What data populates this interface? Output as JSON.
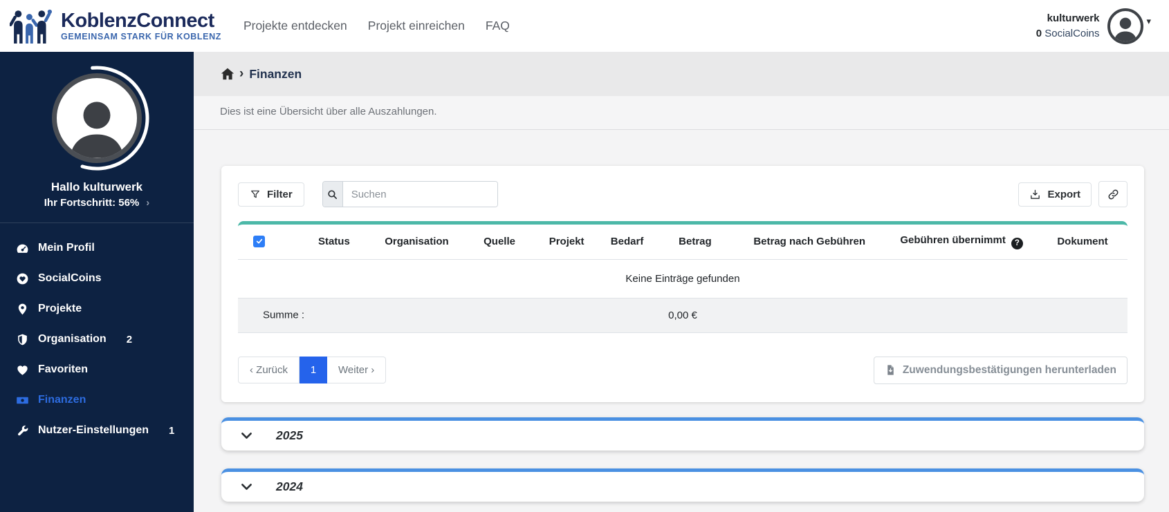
{
  "header": {
    "logo_title": "KoblenzConnect",
    "logo_tagline": "GEMEINSAM STARK FÜR KOBLENZ",
    "nav": [
      {
        "label": "Projekte entdecken"
      },
      {
        "label": "Projekt einreichen"
      },
      {
        "label": "FAQ"
      }
    ],
    "user": {
      "name": "kulturwerk",
      "coins_count": "0",
      "coins_label": "SocialCoins",
      "caret": "▾"
    }
  },
  "sidebar": {
    "greeting": "Hallo kulturwerk",
    "progress_label": "Ihr Fortschritt: 56%",
    "progress_percent": 56,
    "progress_chevron": "›",
    "items": [
      {
        "label": "Mein Profil",
        "icon": "tachometer-icon",
        "badge": "",
        "active": false
      },
      {
        "label": "SocialCoins",
        "icon": "coin-heart-icon",
        "badge": "",
        "active": false
      },
      {
        "label": "Projekte",
        "icon": "map-marker-icon",
        "badge": "",
        "active": false
      },
      {
        "label": "Organisation",
        "icon": "shield-icon",
        "badge": "2",
        "active": false
      },
      {
        "label": "Favoriten",
        "icon": "heart-icon",
        "badge": "",
        "active": false
      },
      {
        "label": "Finanzen",
        "icon": "money-bill-icon",
        "badge": "",
        "active": true
      },
      {
        "label": "Nutzer-Einstellungen",
        "icon": "wrench-icon",
        "badge": "1",
        "active": false
      }
    ]
  },
  "breadcrumb": {
    "home_icon": "home-icon",
    "separator": "›",
    "current": "Finanzen"
  },
  "page": {
    "description": "Dies ist eine Übersicht über alle Auszahlungen."
  },
  "toolbar": {
    "filter_label": "Filter",
    "search_placeholder": "Suchen",
    "export_label": "Export",
    "link_icon": "link-icon"
  },
  "table": {
    "columns": [
      "Status",
      "Organisation",
      "Quelle",
      "Projekt",
      "Bedarf",
      "Betrag",
      "Betrag nach Gebühren",
      "Gebühren übernimmt",
      "Dokument"
    ],
    "help_icon": "?",
    "empty_text": "Keine Einträge gefunden",
    "sum_label": "Summe :",
    "sum_value": "0,00 €"
  },
  "pagination": {
    "prev_label": "‹ Zurück",
    "current_page": "1",
    "next_label": "Weiter ›"
  },
  "actions": {
    "download_label": "Zuwendungsbestätigungen herunterladen"
  },
  "accordions": [
    {
      "year": "2025"
    },
    {
      "year": "2024"
    }
  ],
  "colors": {
    "sidebar_bg": "#0d2242",
    "active_link_blue": "#2d6ce0",
    "table_top_border_teal": "#4cb8a8",
    "accordion_top_border_blue": "#4a90e2",
    "pagination_active_blue": "#2563eb",
    "checkbox_blue": "#2d7ef7",
    "logo_navy": "#1b2a5b",
    "logo_blue": "#3a66ad"
  }
}
